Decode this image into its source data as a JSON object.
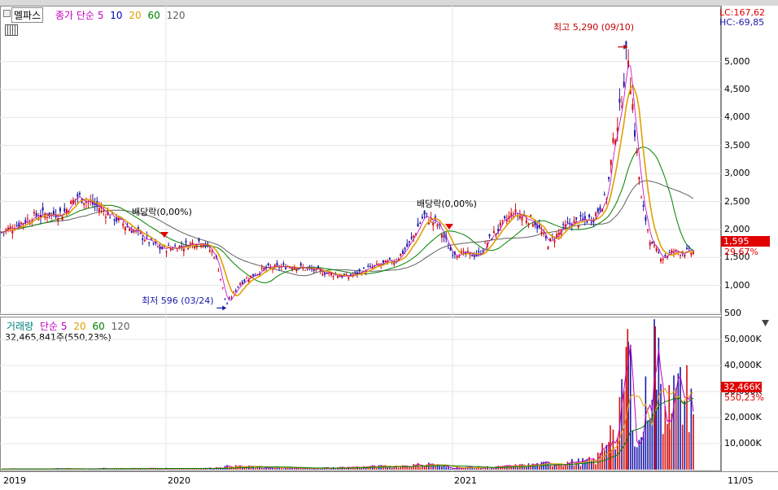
{
  "header": {
    "stock_name": "멜파스",
    "legend_label": "종가 단순",
    "ma_periods": [
      "5",
      "10",
      "20",
      "60",
      "120"
    ],
    "ma_colors": [
      "#c000c0",
      "#0000c0",
      "#e0a000",
      "#008000",
      "#606060"
    ]
  },
  "price_panel": {
    "lc_label": "LC:167,62",
    "hc_label": "HC:-69,85",
    "current_price_tag": "1,595",
    "current_change_tag": "29,67%",
    "high_annotation": "최고 5,290 (09/10)",
    "low_annotation": "최저 596 (03/24)",
    "dividend_annotation_1": "배당락(0,00%)",
    "dividend_annotation_2": "배당락(0,00%)",
    "y_ticks": [
      "5,000",
      "4,500",
      "4,000",
      "3,500",
      "3,000",
      "2,500",
      "2,000",
      "1,500",
      "1,000",
      "500"
    ]
  },
  "volume_panel": {
    "legend_label": "거래량",
    "legend_ma_label": "단순",
    "ma_periods": [
      "5",
      "20",
      "60",
      "120"
    ],
    "volume_readout": "32,465,841주(550,23%)",
    "current_volume_tag": "32,466K",
    "current_volume_pct": "550,23%",
    "y_ticks": [
      "50,000K",
      "40,000K",
      "30,000K",
      "20,000K",
      "10,000K"
    ]
  },
  "x_axis": {
    "labels": [
      "2019",
      "2020",
      "2021",
      "11/05"
    ]
  },
  "colors": {
    "up": "#d01010",
    "down": "#1a1aa8",
    "accent_red": "#e00000",
    "ma5": "#c000c0",
    "ma20": "#e0a000",
    "ma60": "#008000",
    "ma120": "#606060"
  },
  "chart_data": {
    "type": "candlestick",
    "series_summary": {
      "high": {
        "value": 5290,
        "date": "09/10"
      },
      "low": {
        "value": 596,
        "date": "03/24"
      },
      "last": 1595,
      "last_volume_k": 32466
    },
    "x": [
      "2019",
      "2020",
      "2021",
      "11/05"
    ],
    "price_ylim": [
      500,
      5300
    ],
    "volume_ylim": [
      0,
      55000
    ],
    "price_keypoints": [
      {
        "t": 0.0,
        "v": 1950
      },
      {
        "t": 0.05,
        "v": 2250
      },
      {
        "t": 0.09,
        "v": 2300
      },
      {
        "t": 0.11,
        "v": 2600
      },
      {
        "t": 0.14,
        "v": 2400
      },
      {
        "t": 0.17,
        "v": 2150
      },
      {
        "t": 0.2,
        "v": 1900
      },
      {
        "t": 0.23,
        "v": 1650
      },
      {
        "t": 0.26,
        "v": 1700
      },
      {
        "t": 0.29,
        "v": 1800
      },
      {
        "t": 0.31,
        "v": 1500
      },
      {
        "t": 0.325,
        "v": 650
      },
      {
        "t": 0.345,
        "v": 1050
      },
      {
        "t": 0.38,
        "v": 1300
      },
      {
        "t": 0.42,
        "v": 1350
      },
      {
        "t": 0.46,
        "v": 1250
      },
      {
        "t": 0.5,
        "v": 1150
      },
      {
        "t": 0.53,
        "v": 1300
      },
      {
        "t": 0.57,
        "v": 1450
      },
      {
        "t": 0.59,
        "v": 1750
      },
      {
        "t": 0.61,
        "v": 2250
      },
      {
        "t": 0.63,
        "v": 2100
      },
      {
        "t": 0.65,
        "v": 1600
      },
      {
        "t": 0.67,
        "v": 1550
      },
      {
        "t": 0.69,
        "v": 1550
      },
      {
        "t": 0.71,
        "v": 1900
      },
      {
        "t": 0.74,
        "v": 2300
      },
      {
        "t": 0.77,
        "v": 2150
      },
      {
        "t": 0.79,
        "v": 1750
      },
      {
        "t": 0.82,
        "v": 2100
      },
      {
        "t": 0.855,
        "v": 2200
      },
      {
        "t": 0.875,
        "v": 2600
      },
      {
        "t": 0.885,
        "v": 3600
      },
      {
        "t": 0.895,
        "v": 4200
      },
      {
        "t": 0.905,
        "v": 5290
      },
      {
        "t": 0.915,
        "v": 3800
      },
      {
        "t": 0.925,
        "v": 2500
      },
      {
        "t": 0.94,
        "v": 1700
      },
      {
        "t": 0.955,
        "v": 1500
      },
      {
        "t": 0.97,
        "v": 1600
      },
      {
        "t": 1.0,
        "v": 1595
      }
    ],
    "volume_keypoints": [
      {
        "t": 0.0,
        "v": 300
      },
      {
        "t": 0.3,
        "v": 600
      },
      {
        "t": 0.33,
        "v": 1500
      },
      {
        "t": 0.44,
        "v": 500
      },
      {
        "t": 0.59,
        "v": 1800
      },
      {
        "t": 0.62,
        "v": 2500
      },
      {
        "t": 0.65,
        "v": 800
      },
      {
        "t": 0.72,
        "v": 1200
      },
      {
        "t": 0.86,
        "v": 4000
      },
      {
        "t": 0.88,
        "v": 17000
      },
      {
        "t": 0.89,
        "v": 12000
      },
      {
        "t": 0.905,
        "v": 54000
      },
      {
        "t": 0.92,
        "v": 8000
      },
      {
        "t": 0.945,
        "v": 55000
      },
      {
        "t": 0.955,
        "v": 28000
      },
      {
        "t": 0.965,
        "v": 32466
      }
    ]
  }
}
